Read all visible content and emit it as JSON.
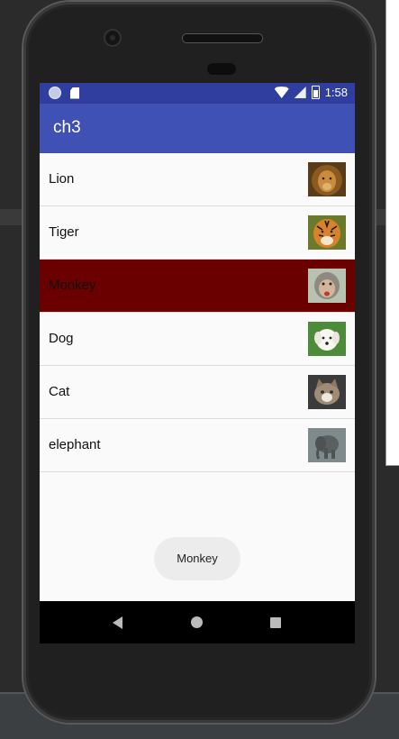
{
  "status_bar": {
    "time": "1:58"
  },
  "app_bar": {
    "title": "ch3"
  },
  "animals": [
    {
      "label": "Lion",
      "icon": "lion-photo",
      "selected": false
    },
    {
      "label": "Tiger",
      "icon": "tiger-photo",
      "selected": false
    },
    {
      "label": "Monkey",
      "icon": "monkey-photo",
      "selected": true
    },
    {
      "label": "Dog",
      "icon": "dog-photo",
      "selected": false
    },
    {
      "label": "Cat",
      "icon": "cat-photo",
      "selected": false
    },
    {
      "label": "elephant",
      "icon": "elephant-photo",
      "selected": false
    }
  ],
  "toast": {
    "text": "Monkey"
  },
  "colors": {
    "status_bar": "#303f9f",
    "app_bar": "#3f51b5",
    "selected_row": "#6b0000",
    "list_background": "#fafafa"
  }
}
